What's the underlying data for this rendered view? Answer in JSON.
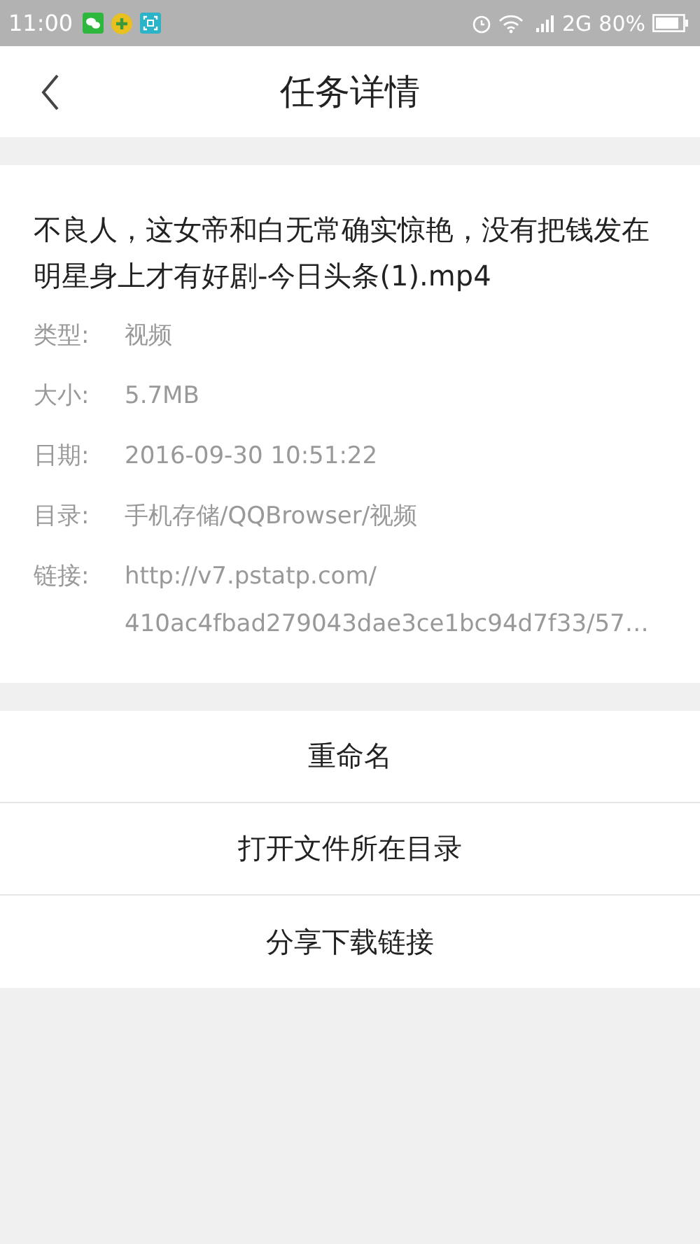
{
  "status_bar": {
    "time": "11:00",
    "network": "2G",
    "battery": "80%"
  },
  "header": {
    "title": "任务详情"
  },
  "file": {
    "name": "不良人，这女帝和白无常确实惊艳，没有把钱发在明星身上才有好剧-今日头条(1).mp4",
    "details": [
      {
        "label": "类型:",
        "lines": [
          "视频"
        ]
      },
      {
        "label": "大小:",
        "lines": [
          "5.7MB"
        ]
      },
      {
        "label": "日期:",
        "lines": [
          "2016-09-30 10:51:22"
        ]
      },
      {
        "label": "目录:",
        "lines": [
          "手机存储/QQBrowser/视频"
        ]
      },
      {
        "label": "链接:",
        "lines": [
          "http://v7.pstatp.com/",
          "410ac4fbad279043dae3ce1bc94d7f33/57…"
        ]
      }
    ]
  },
  "actions": [
    "重命名",
    "打开文件所在目录",
    "分享下载链接"
  ]
}
